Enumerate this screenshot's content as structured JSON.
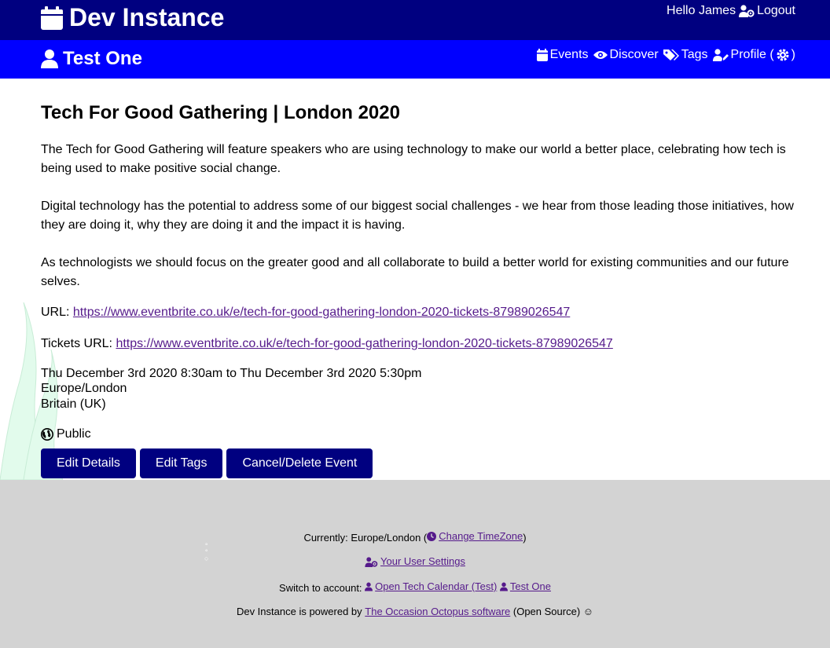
{
  "header": {
    "site_title": "Dev Instance",
    "greeting": "Hello James",
    "logout_label": "Logout",
    "icon": "calendar-icon"
  },
  "account_bar": {
    "title": "Test One",
    "icon": "user-icon",
    "nav": {
      "events": "Events",
      "discover": "Discover",
      "tags": "Tags",
      "profile": "Profile (",
      "profile_close": ")"
    }
  },
  "event": {
    "title": "Tech For Good Gathering | London 2020",
    "description": [
      "The Tech for Good Gathering will feature speakers who are using technology to make our world a better place, celebrating how tech is being used to make positive social change.",
      "Digital technology has the potential to address some of our biggest social challenges - we hear from those leading those initiatives, how they are doing it, why they are doing it and the impact it is having.",
      "As technologists we should focus on the greater good and all collaborate to build a better world for existing communities and our future selves."
    ],
    "url_label": "URL:",
    "url": "https://www.eventbrite.co.uk/e/tech-for-good-gathering-london-2020-tickets-87989026547",
    "tickets_url_label": "Tickets URL:",
    "tickets_url": "https://www.eventbrite.co.uk/e/tech-for-good-gathering-london-2020-tickets-87989026547",
    "datetime": "Thu December 3rd 2020 8:30am to Thu December 3rd 2020 5:30pm",
    "timezone": "Europe/London",
    "country": "Britain (UK)",
    "visibility": "Public"
  },
  "actions": {
    "edit_details": "Edit Details",
    "edit_tags": "Edit Tags",
    "cancel_delete": "Cancel/Delete Event"
  },
  "footer": {
    "currently_prefix": "Currently: Europe/London (",
    "change_timezone": "Change TimeZone",
    "currently_suffix": ")",
    "user_settings": "Your User Settings",
    "switch_prefix": "Switch to account:",
    "account_1": "Open Tech Calendar (Test)",
    "account_2": "Test One",
    "powered_prefix": "Dev Instance is powered by",
    "powered_link": "The Occasion Octopus software",
    "powered_suffix": "(Open Source) ☺"
  },
  "colors": {
    "topbar": "#000080",
    "subbar": "#0000ff",
    "button": "#000080",
    "footer": "#d3d3d3",
    "link": "#551a8b"
  }
}
